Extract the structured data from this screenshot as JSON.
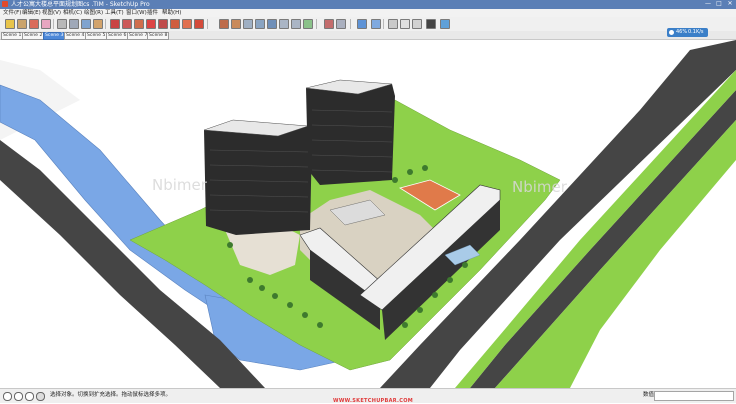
{
  "window": {
    "title": "人才公寓大楼总平面规划图cs .TIM - SketchUp Pro",
    "controls": [
      "—",
      "□",
      "✕"
    ]
  },
  "menu": {
    "items": [
      "文件(F)",
      "编辑(E)",
      "视图(V)",
      "相机(C)",
      "绘图(R)",
      "工具(T)",
      "窗口(W)",
      "插件",
      "帮助(H)"
    ]
  },
  "toolbar": {
    "tools": [
      "select",
      "component",
      "paint-bucket",
      "eraser",
      "rectangle",
      "line",
      "circle",
      "arc",
      "polygon",
      "freehand",
      "move",
      "push-pull",
      "rotate",
      "follow-me",
      "scale",
      "offset",
      "tape-measure",
      "dimension",
      "protractor",
      "text",
      "axes",
      "3d-text",
      "orbit",
      "pan",
      "zoom",
      "zoom-window",
      "zoom-extents",
      "previous",
      "next",
      "position-camera",
      "walk",
      "look-around",
      "section-plane",
      "iso",
      "top",
      "front",
      "right",
      "back",
      "left",
      "xray",
      "wireframe",
      "hidden-line",
      "shaded",
      "shaded-textures",
      "monochrome"
    ]
  },
  "scenes": {
    "tabs": [
      "Scene 1",
      "Scene 2",
      "Scene 3",
      "Scene 4",
      "Scene 5",
      "Scene 6",
      "Scene 7",
      "Scene 8"
    ],
    "active_index": 2
  },
  "speed_badge": {
    "percent": "46%",
    "rate": "0.1K/s",
    "color": "#3b7fc8"
  },
  "viewport": {
    "watermark_left": "Nbimer",
    "watermark_right": "Nbimer",
    "site_url": "WWW.SKETCHUPBAR.COM",
    "colors": {
      "grass": "#8ed14a",
      "water": "#7aa7e6",
      "road": "#454545",
      "plaza": "#d9d2c2",
      "tower": "#2c2c2c"
    }
  },
  "status": {
    "message": "选择对象。切换到扩充选择。拖动鼠标选择多项。",
    "measure_label": "数值",
    "measure_value": ""
  }
}
